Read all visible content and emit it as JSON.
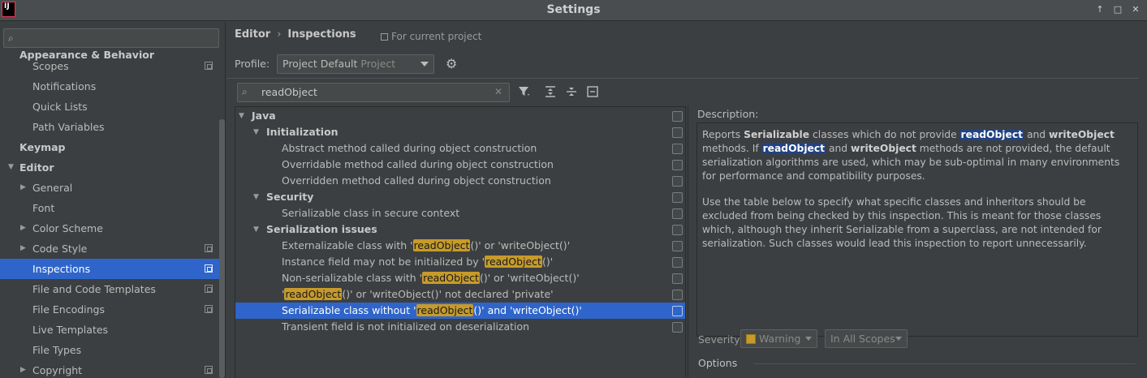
{
  "window": {
    "title": "Settings",
    "controls": [
      "↑",
      "□",
      "✕"
    ]
  },
  "sidebar": {
    "search": {
      "placeholder": "",
      "value": ""
    },
    "items": [
      {
        "label": "Appearance & Behavior",
        "level": 0,
        "bold": true,
        "arrow": "",
        "config": false
      },
      {
        "label": "Scopes",
        "level": 1,
        "bold": false,
        "arrow": "",
        "config": true
      },
      {
        "label": "Notifications",
        "level": 1,
        "bold": false,
        "arrow": "",
        "config": false
      },
      {
        "label": "Quick Lists",
        "level": 1,
        "bold": false,
        "arrow": "",
        "config": false
      },
      {
        "label": "Path Variables",
        "level": 1,
        "bold": false,
        "arrow": "",
        "config": false
      },
      {
        "label": "Keymap",
        "level": 0,
        "bold": true,
        "arrow": "",
        "config": false
      },
      {
        "label": "Editor",
        "level": 0,
        "bold": true,
        "arrow": "expanded",
        "config": false
      },
      {
        "label": "General",
        "level": 1,
        "bold": false,
        "arrow": "collapsed",
        "config": false
      },
      {
        "label": "Font",
        "level": 1,
        "bold": false,
        "arrow": "",
        "config": false
      },
      {
        "label": "Color Scheme",
        "level": 1,
        "bold": false,
        "arrow": "collapsed",
        "config": false
      },
      {
        "label": "Code Style",
        "level": 1,
        "bold": false,
        "arrow": "collapsed",
        "config": true
      },
      {
        "label": "Inspections",
        "level": 1,
        "bold": false,
        "arrow": "",
        "config": true,
        "selected": true
      },
      {
        "label": "File and Code Templates",
        "level": 1,
        "bold": false,
        "arrow": "",
        "config": true
      },
      {
        "label": "File Encodings",
        "level": 1,
        "bold": false,
        "arrow": "",
        "config": true
      },
      {
        "label": "Live Templates",
        "level": 1,
        "bold": false,
        "arrow": "",
        "config": false
      },
      {
        "label": "File Types",
        "level": 1,
        "bold": false,
        "arrow": "",
        "config": false
      },
      {
        "label": "Copyright",
        "level": 1,
        "bold": false,
        "arrow": "collapsed",
        "config": true
      }
    ]
  },
  "header": {
    "breadcrumb": [
      "Editor",
      "Inspections"
    ],
    "breadcrumb_sep": "›",
    "for_project": "For current project"
  },
  "profile": {
    "label": "Profile:",
    "value": "Project Default",
    "sub": "Project",
    "settings_icon": "gear-icon"
  },
  "filter": {
    "value": "readObject",
    "clear": "✕"
  },
  "toolbar": {
    "filter_icon": "filter-icon",
    "expand_all_icon": "expand-all-icon",
    "collapse_all_icon": "collapse-all-icon",
    "reset_icon": "reset-icon"
  },
  "inspections": [
    {
      "type": "group",
      "level": 0,
      "parts": [
        "Java"
      ]
    },
    {
      "type": "group",
      "level": 1,
      "parts": [
        "Initialization"
      ]
    },
    {
      "type": "item",
      "level": 2,
      "parts": [
        "Abstract method called during object construction"
      ]
    },
    {
      "type": "item",
      "level": 2,
      "parts": [
        "Overridable method called during object construction"
      ]
    },
    {
      "type": "item",
      "level": 2,
      "parts": [
        "Overridden method called during object construction"
      ]
    },
    {
      "type": "group",
      "level": 1,
      "parts": [
        "Security"
      ]
    },
    {
      "type": "item",
      "level": 2,
      "parts": [
        "Serializable class in secure context"
      ]
    },
    {
      "type": "group",
      "level": 1,
      "parts": [
        "Serialization issues"
      ]
    },
    {
      "type": "item",
      "level": 2,
      "parts": [
        "Externalizable class with '",
        "readObject",
        "()' or 'writeObject()'"
      ]
    },
    {
      "type": "item",
      "level": 2,
      "parts": [
        "Instance field may not be initialized by '",
        "readObject",
        "()'"
      ]
    },
    {
      "type": "item",
      "level": 2,
      "parts": [
        "Non-serializable class with '",
        "readObject",
        "()' or 'writeObject()'"
      ]
    },
    {
      "type": "item",
      "level": 2,
      "parts": [
        "'",
        "readObject",
        "()' or 'writeObject()' not declared 'private'"
      ]
    },
    {
      "type": "item",
      "level": 2,
      "parts": [
        "Serializable class without '",
        "readObject",
        "()' and 'writeObject()'"
      ],
      "selected": true
    },
    {
      "type": "item",
      "level": 2,
      "parts": [
        "Transient field is not initialized on deserialization"
      ]
    }
  ],
  "description": {
    "label": "Description:",
    "p1": {
      "t1": "Reports ",
      "b1": "Serializable",
      "t2": " classes which do not provide ",
      "k1": "readObject",
      "t3": " and ",
      "b2": "writeObject",
      "t4": " methods. If ",
      "k2": "readObject",
      "t5": " and ",
      "b3": "writeObject",
      "t6": " methods are not provided, the default serialization algorithms are used, which may be sub-optimal in many environments for performance and compatibility purposes."
    },
    "p2": "Use the table below to specify what specific classes and inheritors should be excluded from being checked by this inspection. This is meant for those classes which, although they inherit Serializable from a superclass, are not intended for serialization. Such classes would lead this inspection to report unnecessarily."
  },
  "severity": {
    "label": "Severity:",
    "value": "Warning",
    "swatch_color": "#c69b2b",
    "scope": "In All Scopes"
  },
  "options": {
    "label": "Options"
  },
  "colors": {
    "selection": "#2f65ca",
    "match_highlight": "#c69b2b",
    "keyword_highlight": "#214283"
  }
}
